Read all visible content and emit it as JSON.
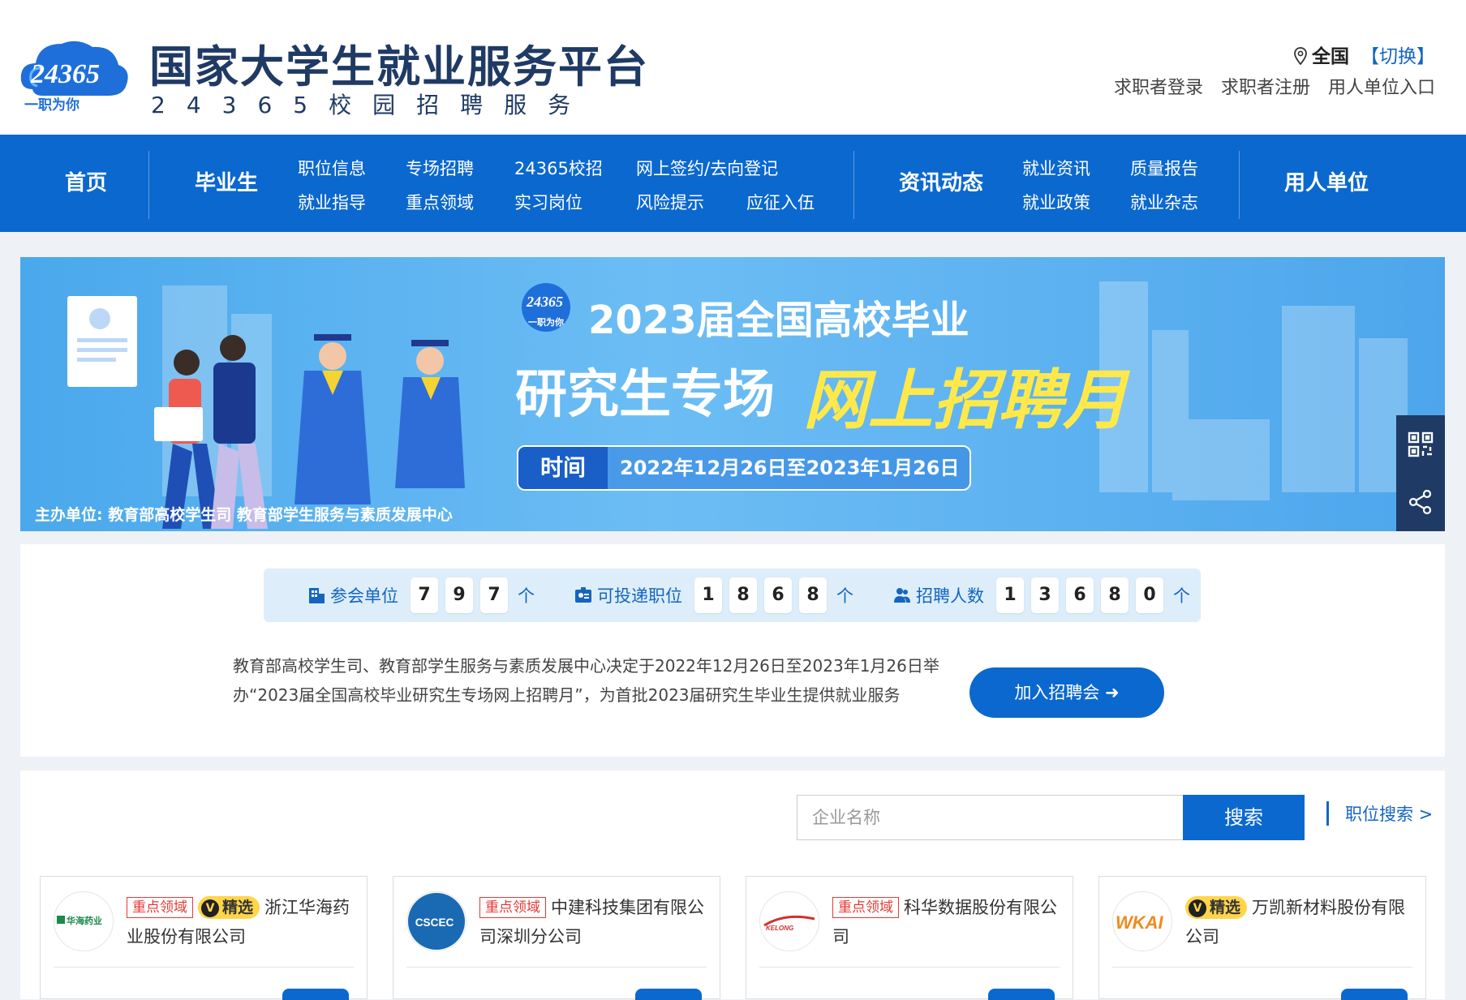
{
  "header": {
    "logo_number": "24365",
    "logo_slogan": "一职为你",
    "title": "国家大学生就业服务平台",
    "subtitle": "24365校园招聘服务",
    "location": {
      "current": "全国",
      "switch_label": "【切换】"
    },
    "user_links": [
      "求职者登录",
      "求职者注册",
      "用人单位入口"
    ]
  },
  "nav": {
    "home": "首页",
    "graduates": "毕业生",
    "graduate_links": [
      "职位信息",
      "专场招聘",
      "24365校招",
      "网上签约/去向登记",
      "就业指导",
      "重点领域",
      "实习岗位",
      "风险提示",
      "应征入伍"
    ],
    "news": "资讯动态",
    "news_links": [
      "就业资讯",
      "质量报告",
      "就业政策",
      "就业杂志"
    ],
    "employers": "用人单位"
  },
  "banner": {
    "logo_number": "24365",
    "logo_slogan": "一职为你",
    "title_line1": "2023届全国高校毕业",
    "title_line2_a": "研究生专场",
    "title_line2_b": "网上招聘月",
    "time_label": "时间",
    "time_value": "2022年12月26日至2023年1月26日",
    "host": "主办单位: 教育部高校学生司  教育部学生服务与素质发展中心"
  },
  "side_tools": [
    "qrcode-icon",
    "share-icon"
  ],
  "stats": {
    "units": {
      "label": "参会单位",
      "digits": [
        "7",
        "9",
        "7"
      ],
      "unit": "个"
    },
    "positions": {
      "label": "可投递职位",
      "digits": [
        "1",
        "8",
        "6",
        "8"
      ],
      "unit": "个"
    },
    "hires": {
      "label": "招聘人数",
      "digits": [
        "1",
        "3",
        "6",
        "8",
        "0"
      ],
      "unit": "个"
    }
  },
  "intro": "教育部高校学生司、教育部学生服务与素质发展中心决定于2022年12月26日至2023年1月26日举办“2023届全国高校毕业研究生专场网上招聘月”，为首批2023届研究生毕业生提供就业服务",
  "join_button": "加入招聘会 ➜",
  "search": {
    "placeholder": "企业名称",
    "button": "搜索",
    "position_search": "职位搜索 >"
  },
  "companies": [
    {
      "key_tag": "重点领域",
      "selected_tag": "精选",
      "name": "浙江华海药业股份有限公司",
      "logo_text": "华海药业"
    },
    {
      "key_tag": "重点领域",
      "selected_tag": "",
      "name": "中建科技集团有限公司深圳分公司",
      "logo_text": "CSCEC"
    },
    {
      "key_tag": "重点领域",
      "selected_tag": "",
      "name": "科华数据股份有限公司",
      "logo_text": "KELONG"
    },
    {
      "key_tag": "",
      "selected_tag": "精选",
      "name": "万凯新材料股份有限公司",
      "logo_text": "WKAI"
    }
  ],
  "colors": {
    "nav_blue": "#0b68cf",
    "title_navy": "#1f3a64",
    "tag_red": "#e53935",
    "tag_yellow": "#ffd54a"
  }
}
